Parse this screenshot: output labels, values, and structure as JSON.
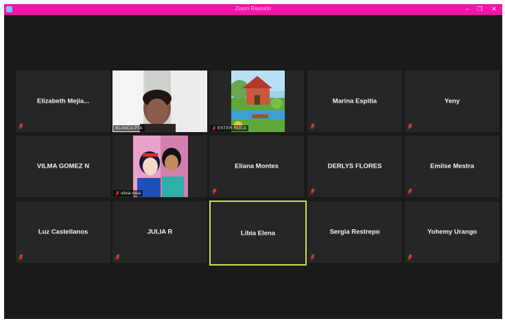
{
  "window": {
    "title": "Zoom Reunión",
    "controls": {
      "minimize": "–",
      "maximize": "❐",
      "close": "✕"
    }
  },
  "colors": {
    "titlebar": "#f115a8",
    "tile": "#262626",
    "background": "#1a1a1a",
    "active_border": "#c9e05a",
    "muted_mic": "#e0433a"
  },
  "participants": {
    "elizabeth": {
      "name": "Elizabeth  Mejía...",
      "muted": true
    },
    "blanca": {
      "name": "BLANCA PTA",
      "video": "webcam-person"
    },
    "ester": {
      "name": "ESTER ROCA",
      "video": "house-illustration",
      "muted": true
    },
    "marina": {
      "name": "Marina Espitia",
      "muted": true
    },
    "yeny": {
      "name": "Yeny",
      "muted": true
    },
    "vilma": {
      "name": "VILMA GOMEZ N",
      "muted": false
    },
    "silvia": {
      "name": "silvia rosa",
      "video": "princess-illustration",
      "muted": true
    },
    "eliana": {
      "name": "Eliana Montes",
      "muted": true
    },
    "derlys": {
      "name": "DERLYS FLORES",
      "muted": true
    },
    "emilse": {
      "name": "Emilse Mestra",
      "muted": true
    },
    "luz": {
      "name": "Luz Castellanos",
      "muted": true
    },
    "julia": {
      "name": "JULIA R",
      "muted": true
    },
    "libia": {
      "name": "Libia Elena",
      "muted": false,
      "active_speaker": true
    },
    "sergia": {
      "name": "Sergia Restrepo",
      "muted": true
    },
    "yohemy": {
      "name": "Yohemy Urango",
      "muted": true
    }
  }
}
